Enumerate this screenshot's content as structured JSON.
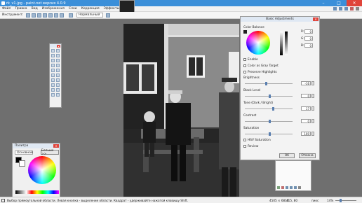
{
  "window": {
    "title": "rk_v1.jpg - paint.net версия 4.0.9"
  },
  "menu": [
    "Файл",
    "Правка",
    "Вид",
    "Изображения",
    "Слои",
    "Коррекция",
    "Эффекты"
  ],
  "toolbar": {
    "tool_label": "Инструмент:",
    "blend_mode": "Нормальный"
  },
  "basic_adjustments": {
    "title": "Basic Adjustments",
    "color_balance_label": "Color Balance",
    "channels": [
      {
        "name": "R:",
        "value": "0"
      },
      {
        "name": "G:",
        "value": "0"
      },
      {
        "name": "B:",
        "value": "0"
      }
    ],
    "enable_label": "Enable",
    "color_as_gray_label": "Color as Gray Target",
    "preserve_highlights_label": "Preserve Highlights",
    "brightness": {
      "label": "Brightness",
      "value": "-16"
    },
    "black_level": {
      "label": "Black Level",
      "value": "0"
    },
    "tone": {
      "label": "Tone (Dark / Bright)",
      "value": "17"
    },
    "contrast": {
      "label": "Contrast",
      "value": "0"
    },
    "saturation": {
      "label": "Saturation",
      "value": "100"
    },
    "hsv_label": "HSV Saturation",
    "review_label": "Review",
    "ok_label": "OK",
    "cancel_label": "Отмена"
  },
  "palette": {
    "title": "Палитра",
    "mode": "Основной",
    "more_label": "Больше >>"
  },
  "status": {
    "hint": "Выбор прямоугольной области. Левая кнопка - выделение области. Квадрат - удерживайте нажатой клавишу Shift.",
    "size": "4505 × 6810",
    "coords": "415, 80",
    "unit": "пикс",
    "zoom": "14%"
  },
  "colors": {
    "titlebar": "#3b8fd9",
    "close": "#e0443a"
  }
}
